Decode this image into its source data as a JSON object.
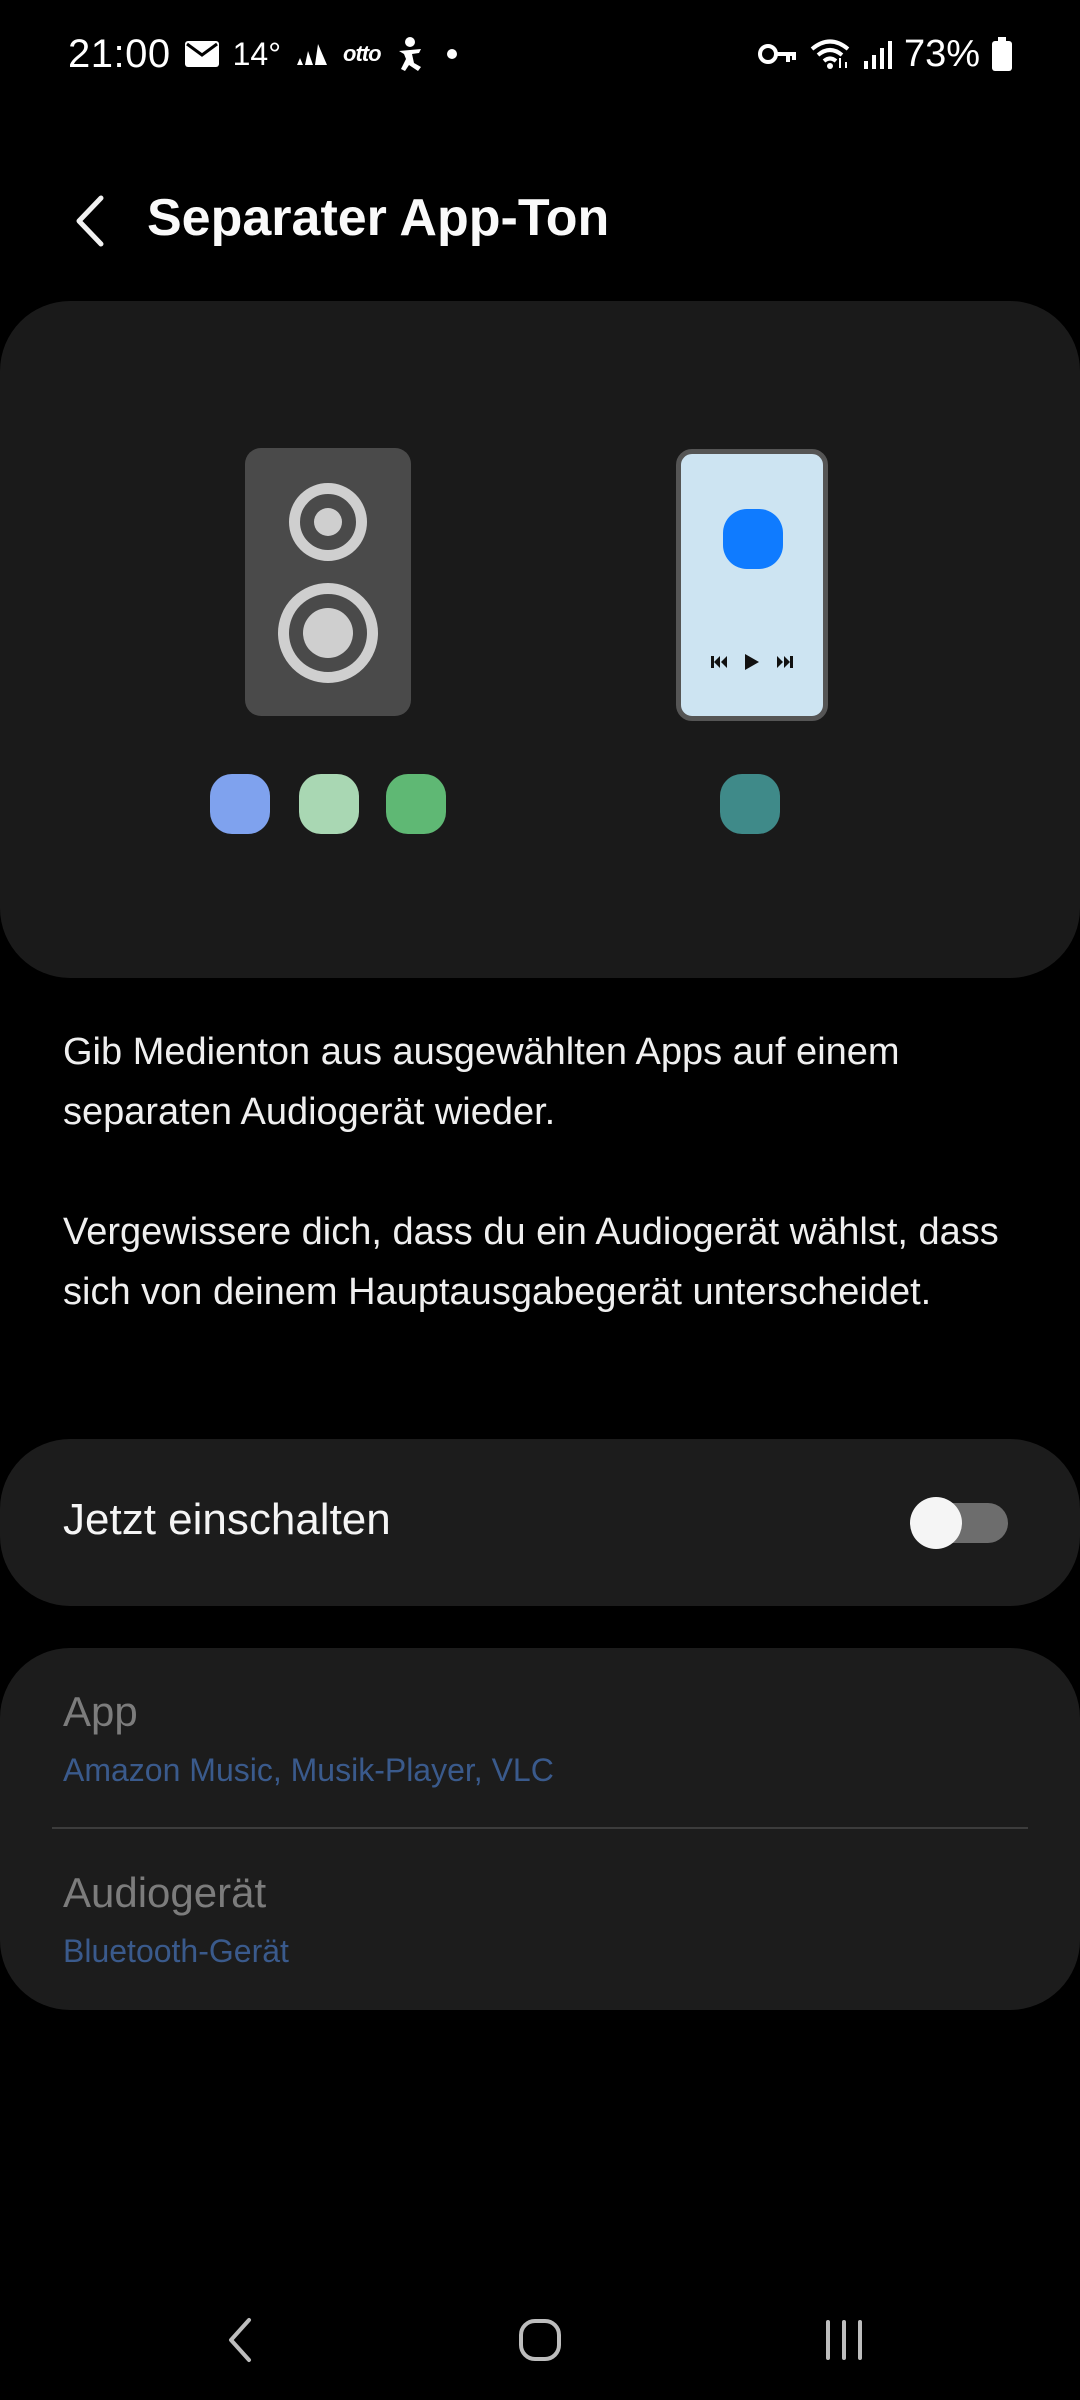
{
  "status_bar": {
    "time": "21:00",
    "temperature": "14°",
    "carrier_tag": "otto",
    "battery": "73%",
    "icons": [
      "mail-icon",
      "adidas-icon",
      "otto-icon",
      "accessibility-icon",
      "notification-dot",
      "vpn-key-icon",
      "wifi-icon",
      "signal-icon",
      "battery-icon"
    ]
  },
  "header": {
    "title": "Separater App-Ton"
  },
  "illustration": {
    "dot_colors": [
      "#7fa2ee",
      "#a9d7b3",
      "#5fb874",
      "#3f8a89"
    ],
    "phone_screen_color": "#cde4f2",
    "phone_app_color": "#0f7bff"
  },
  "description": {
    "paragraph_1": "Gib Medienton aus ausgewählten Apps auf einem separaten Audiogerät wieder.",
    "paragraph_2": "Vergewissere dich, dass du ein Audiogerät wählst, dass sich von deinem Hauptausgabegerät unterscheidet."
  },
  "toggle": {
    "label": "Jetzt einschalten",
    "state": "off"
  },
  "settings": {
    "app": {
      "title": "App",
      "value": "Amazon Music, Musik-Player, VLC"
    },
    "audio_device": {
      "title": "Audiogerät",
      "value": "Bluetooth-Gerät"
    }
  },
  "nav_bar": {
    "icons": [
      "nav-back-icon",
      "nav-home-icon",
      "nav-recents-icon"
    ]
  },
  "colors": {
    "background": "#000000",
    "card": "#1c1c1c",
    "muted_title": "#7c7c7c",
    "link_value": "#3a5a8c"
  }
}
